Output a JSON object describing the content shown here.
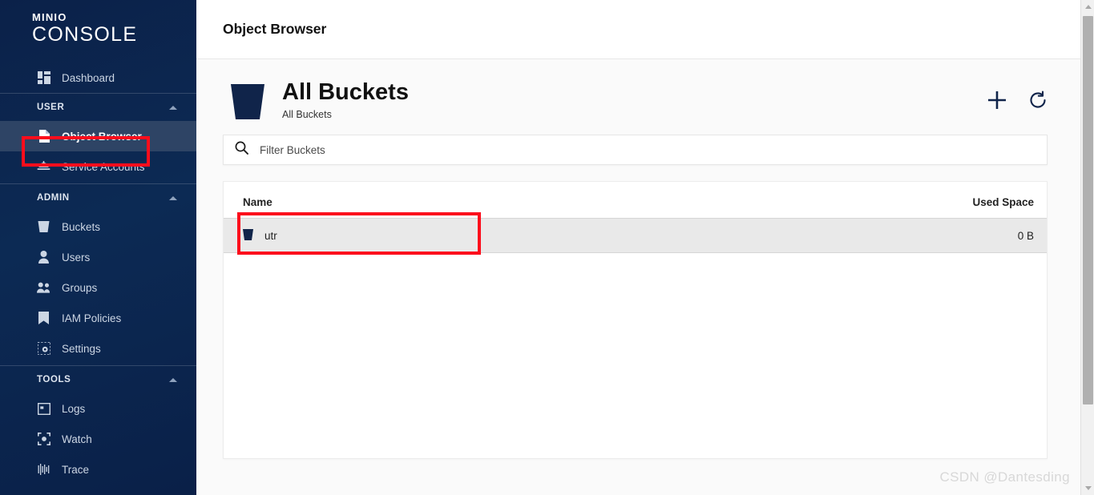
{
  "sidebar": {
    "logo": {
      "top": "MINIO",
      "bottom": "CONSOLE"
    },
    "primary": [
      {
        "label": "Dashboard",
        "icon": "dashboard-icon"
      }
    ],
    "sections": [
      {
        "title": "USER",
        "items": [
          {
            "label": "Object Browser",
            "icon": "document-icon",
            "active": true
          },
          {
            "label": "Service Accounts",
            "icon": "service-bell-icon",
            "active": false
          }
        ]
      },
      {
        "title": "ADMIN",
        "items": [
          {
            "label": "Buckets",
            "icon": "bucket-icon",
            "active": false
          },
          {
            "label": "Users",
            "icon": "user-icon",
            "active": false
          },
          {
            "label": "Groups",
            "icon": "groups-icon",
            "active": false
          },
          {
            "label": "IAM Policies",
            "icon": "bookmark-icon",
            "active": false
          },
          {
            "label": "Settings",
            "icon": "settings-gear-icon",
            "active": false
          }
        ]
      },
      {
        "title": "TOOLS",
        "items": [
          {
            "label": "Logs",
            "icon": "window-icon",
            "active": false
          },
          {
            "label": "Watch",
            "icon": "watch-target-icon",
            "active": false
          },
          {
            "label": "Trace",
            "icon": "trace-icon",
            "active": false
          }
        ]
      }
    ]
  },
  "header": {
    "title": "Object Browser"
  },
  "page": {
    "title": "All Buckets",
    "subtitle": "All Buckets",
    "actions": [
      {
        "name": "add-bucket-button",
        "icon": "plus-icon"
      },
      {
        "name": "refresh-button",
        "icon": "refresh-icon"
      }
    ]
  },
  "search": {
    "placeholder": "Filter Buckets",
    "value": ""
  },
  "table": {
    "columns": [
      "Name",
      "Used Space"
    ],
    "rows": [
      {
        "name": "utr",
        "used_space": "0 B",
        "icon": "bucket-icon"
      }
    ]
  },
  "watermark": "CSDN @Dantesding",
  "colors": {
    "sidebar_bg": "#0b2149",
    "sidebar_active": "#2e4465",
    "accent_navy": "#10244a",
    "annotation_red": "#fc0d1c",
    "row_bg": "#e9e9e9"
  }
}
